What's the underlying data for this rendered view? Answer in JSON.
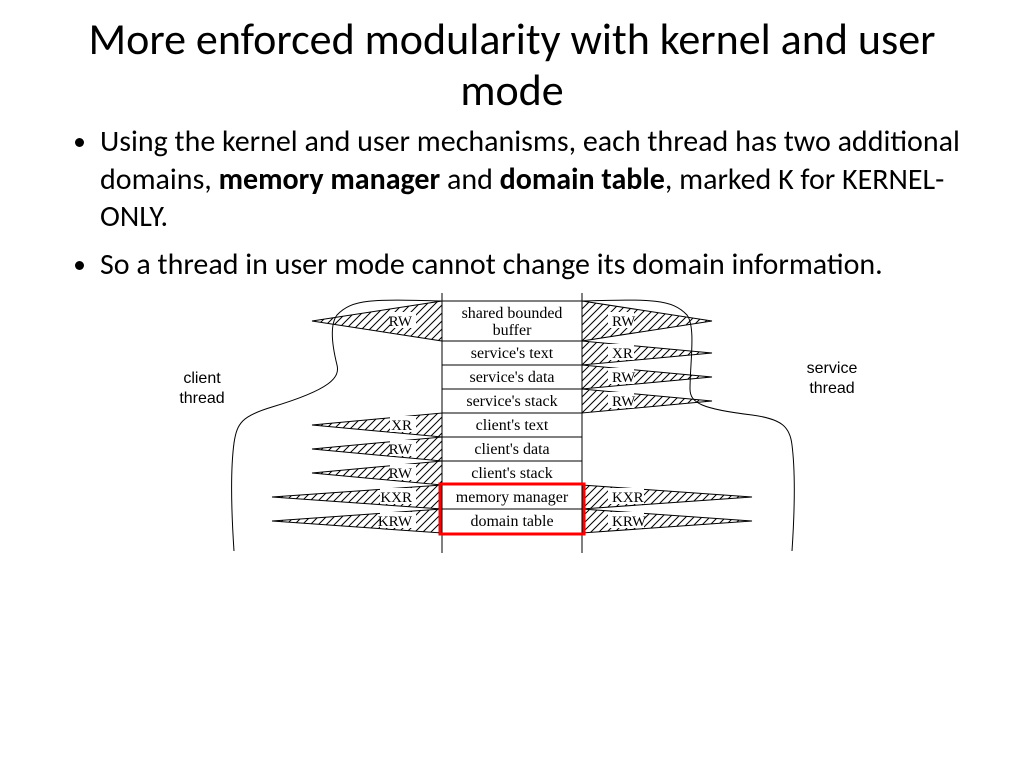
{
  "title": "More enforced modularity with kernel and user mode",
  "bullets": {
    "b1_pre": "Using the kernel and user mechanisms, each thread has two additional domains, ",
    "b1_bold1": "memory manager",
    "b1_mid": " and ",
    "b1_bold2": "domain table",
    "b1_post": ", marked K for KERNEL-ONLY.",
    "b2": "So a thread in user mode cannot change its domain information."
  },
  "diagram": {
    "left_label_l1": "client",
    "left_label_l2": "thread",
    "right_label_l1": "service",
    "right_label_l2": "thread",
    "rows": [
      {
        "name": "shared bounded buffer",
        "left": "RW",
        "right": "RW"
      },
      {
        "name": "service's text",
        "left": "",
        "right": "XR"
      },
      {
        "name": "service's data",
        "left": "",
        "right": "RW"
      },
      {
        "name": "service's stack",
        "left": "",
        "right": "RW"
      },
      {
        "name": "client's text",
        "left": "XR",
        "right": ""
      },
      {
        "name": "client's data",
        "left": "RW",
        "right": ""
      },
      {
        "name": "client's stack",
        "left": "RW",
        "right": ""
      },
      {
        "name": "memory manager",
        "left": "KXR",
        "right": "KXR",
        "highlight": true
      },
      {
        "name": "domain table",
        "left": "KRW",
        "right": "KRW",
        "highlight": true
      }
    ]
  }
}
